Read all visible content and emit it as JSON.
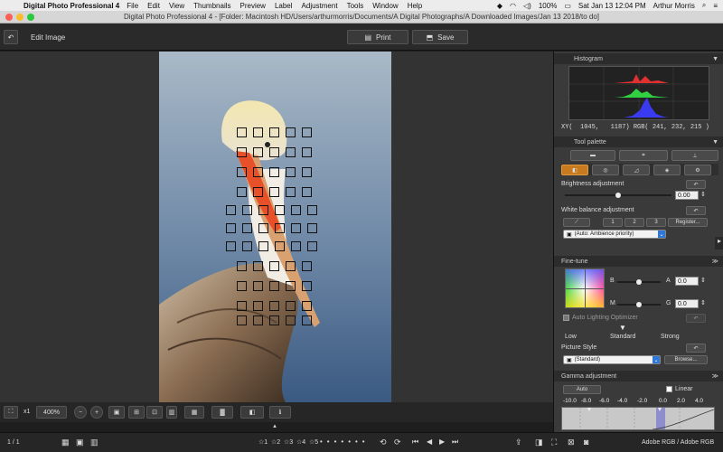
{
  "menubar": {
    "app": "Digital Photo Professional 4",
    "items": [
      "File",
      "Edit",
      "View",
      "Thumbnails",
      "Preview",
      "Label",
      "Adjustment",
      "Tools",
      "Window",
      "Help"
    ],
    "battery": "100%",
    "datetime": "Sat Jan 13  12:04 PM",
    "user": "Arthur Morris"
  },
  "window": {
    "title": "Digital Photo Professional 4 - [Folder: Macintosh HD/Users/arthurmorris/Documents/A Digital Photographs/A Downloaded Images/Jan 13 2018/to do]"
  },
  "toolbar": {
    "mode_label": "Edit Image",
    "print_label": "Print",
    "save_label": "Save"
  },
  "viewer": {
    "zoom_x1": "x1",
    "zoom_level": "400%",
    "frame_counter": "1 / 1"
  },
  "histogram": {
    "title": "Histogram",
    "xy_readout": "XY(  1045,   1187) RGB( 241, 232, 215 )"
  },
  "tool_palette": {
    "title": "Tool palette",
    "brightness": {
      "label": "Brightness adjustment",
      "value": "0.00",
      "level": 0.5
    },
    "white_balance": {
      "label": "White balance adjustment",
      "presets": [
        "1",
        "2",
        "3"
      ],
      "register_label": "Register...",
      "mode": "(Auto: Ambience priority)"
    }
  },
  "fine_tune": {
    "title": "Fine-tune",
    "b_label": "B",
    "a_label": "A",
    "a_value": "0.0",
    "m_label": "M",
    "g_label": "G",
    "g_value": "0.0",
    "alo_label": "Auto Lighting Optimizer",
    "alo_levels": [
      "Low",
      "Standard",
      "Strong"
    ],
    "picture_style_label": "Picture Style",
    "picture_style_value": "(Standard)",
    "browse_label": "Browse..."
  },
  "gamma": {
    "title": "Gamma adjustment",
    "auto_label": "Auto",
    "linear_label": "Linear",
    "scale": [
      "-10.0",
      "-8.0",
      "-6.0",
      "-4.0",
      "-2.0",
      "0.0",
      "2.0",
      "4.0"
    ]
  },
  "statusbar": {
    "frame": "1 / 1",
    "colorspace": "Adobe RGB / Adobe RGB",
    "rating_labels": [
      "1",
      "2",
      "3",
      "4",
      "5"
    ]
  },
  "colors": {
    "accent_blue": "#2f78d6",
    "active_tab": "#c87a1e",
    "bird_orange": "#e8502a"
  }
}
